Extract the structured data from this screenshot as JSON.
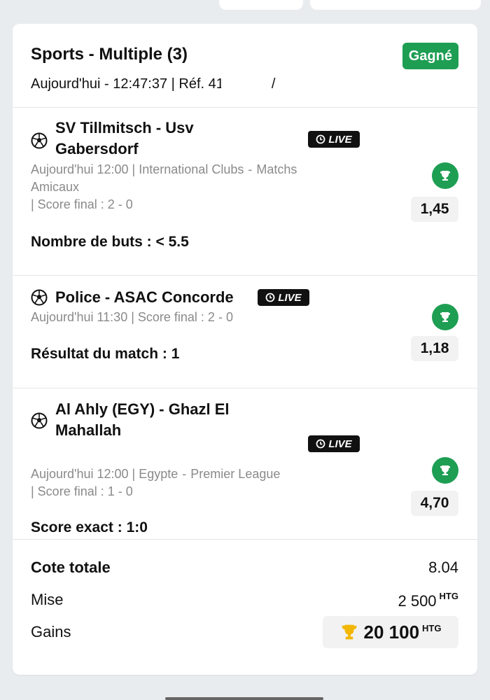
{
  "bet": {
    "title": "Sports - Multiple (3)",
    "date_label": "Aujourd'hui - 12:47:37 | Réf. 41",
    "ref_tail": "/",
    "status": "Gagné"
  },
  "live_label": "LIVE",
  "events": [
    {
      "title_line1": "SV Tillmitsch - Usv",
      "title_line2": "Gabersdorf",
      "meta_time": "Aujourd'hui 12:00 |",
      "meta_league_a": "International Clubs",
      "meta_dash": "-",
      "meta_league_b": "Matchs",
      "meta_league_c": "Amicaux",
      "score": "| Score final : 2 - 0",
      "market": "Nombre de buts : < 5.5",
      "odds": "1,45"
    },
    {
      "title_line1": "Police - ASAC Concorde",
      "meta_time": "Aujourd'hui 11:30 | Score final : 2 - 0",
      "market": "Résultat du match : 1",
      "odds": "1,18"
    },
    {
      "title_line1": "Al Ahly (EGY) - Ghazl El",
      "title_line2": "Mahallah",
      "meta_time": "Aujourd'hui 12:00 |",
      "meta_league_a": "Egypte",
      "meta_dash": "-",
      "meta_league_b": "Premier League",
      "score": "| Score final : 1 - 0",
      "market": "Score exact : 1:0",
      "odds": "4,70"
    }
  ],
  "summary": {
    "total_odds_label": "Cote totale",
    "total_odds_value": "8.04",
    "stake_label": "Mise",
    "stake_value": "2 500",
    "currency": "HTG",
    "winnings_label": "Gains",
    "winnings_value": "20 100"
  },
  "colors": {
    "won": "#1e9e53",
    "live_bg": "#111111",
    "trophy_gold": "#f2b705"
  },
  "icons": [
    "soccer-ball-icon",
    "live-clock-icon",
    "trophy-icon"
  ]
}
